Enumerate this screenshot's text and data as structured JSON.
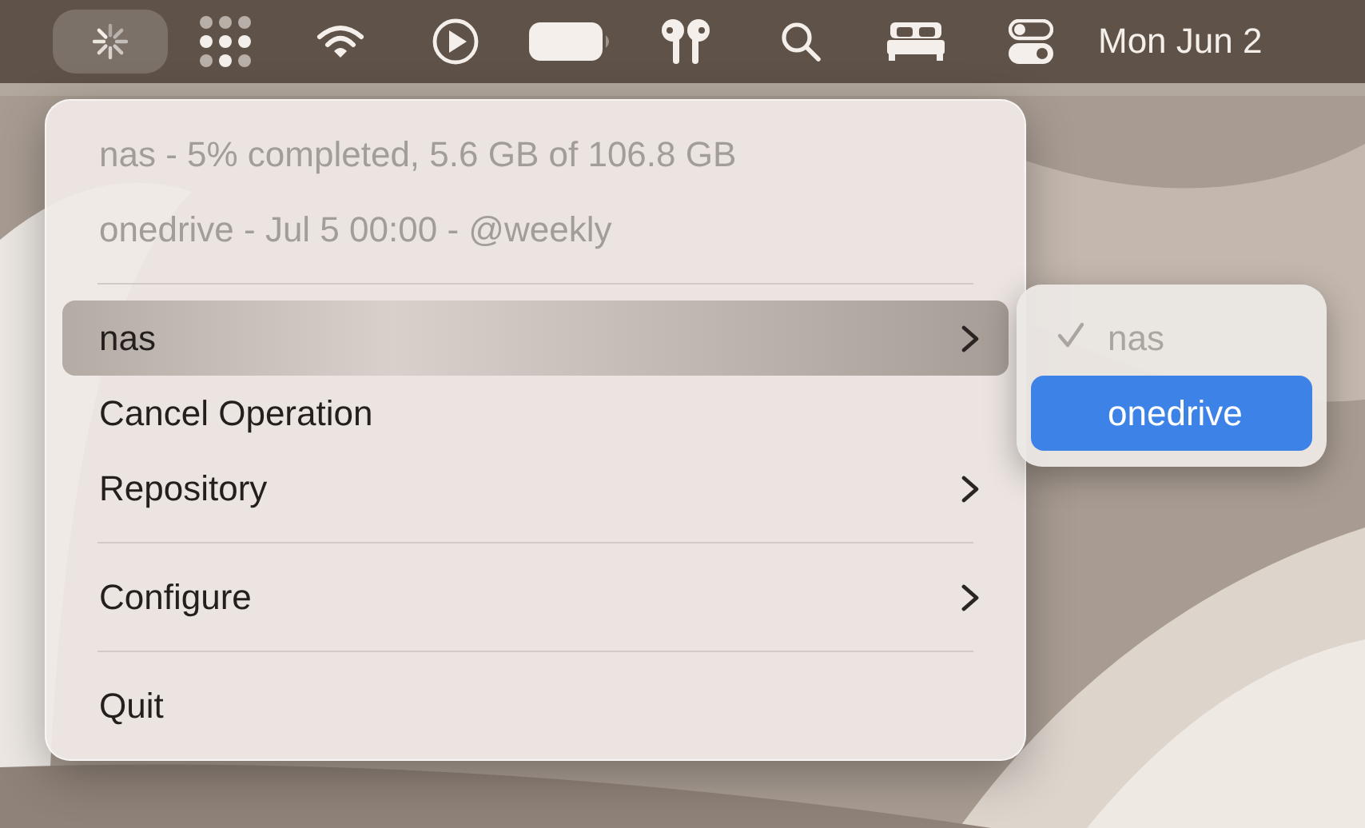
{
  "menu_bar": {
    "items": [
      {
        "kind": "spinner",
        "selected": true
      },
      {
        "kind": "dots",
        "selected": false
      },
      {
        "kind": "wifi",
        "selected": false
      },
      {
        "kind": "play",
        "selected": false
      },
      {
        "kind": "battery",
        "selected": false
      },
      {
        "kind": "earbuds",
        "selected": false
      },
      {
        "kind": "search",
        "selected": false
      },
      {
        "kind": "bed",
        "selected": false
      },
      {
        "kind": "toggles",
        "selected": false
      }
    ],
    "clock": "Mon Jun 2"
  },
  "menu": {
    "items": [
      {
        "kind": "item",
        "label": "nas - 5% completed, 5.6 GB of 106.8 GB",
        "disabled": true,
        "selected": false,
        "submenu": false
      },
      {
        "kind": "item",
        "label": "onedrive - Jul 5 00:00 - @weekly",
        "disabled": true,
        "selected": false,
        "submenu": false
      },
      {
        "kind": "separator"
      },
      {
        "kind": "item",
        "label": "nas",
        "disabled": false,
        "selected": true,
        "submenu": true
      },
      {
        "kind": "item",
        "label": "Cancel Operation",
        "disabled": false,
        "selected": false,
        "submenu": false
      },
      {
        "kind": "item",
        "label": "Repository",
        "disabled": false,
        "selected": false,
        "submenu": true
      },
      {
        "kind": "separator"
      },
      {
        "kind": "item",
        "label": "Configure",
        "disabled": false,
        "selected": false,
        "submenu": true
      },
      {
        "kind": "separator"
      },
      {
        "kind": "item",
        "label": "Quit",
        "disabled": false,
        "selected": false,
        "submenu": false
      }
    ]
  },
  "submenu": {
    "items": [
      {
        "label": "nas",
        "checked": true,
        "disabled": true,
        "selected": false
      },
      {
        "label": "onedrive",
        "checked": false,
        "disabled": false,
        "selected": true
      }
    ]
  }
}
